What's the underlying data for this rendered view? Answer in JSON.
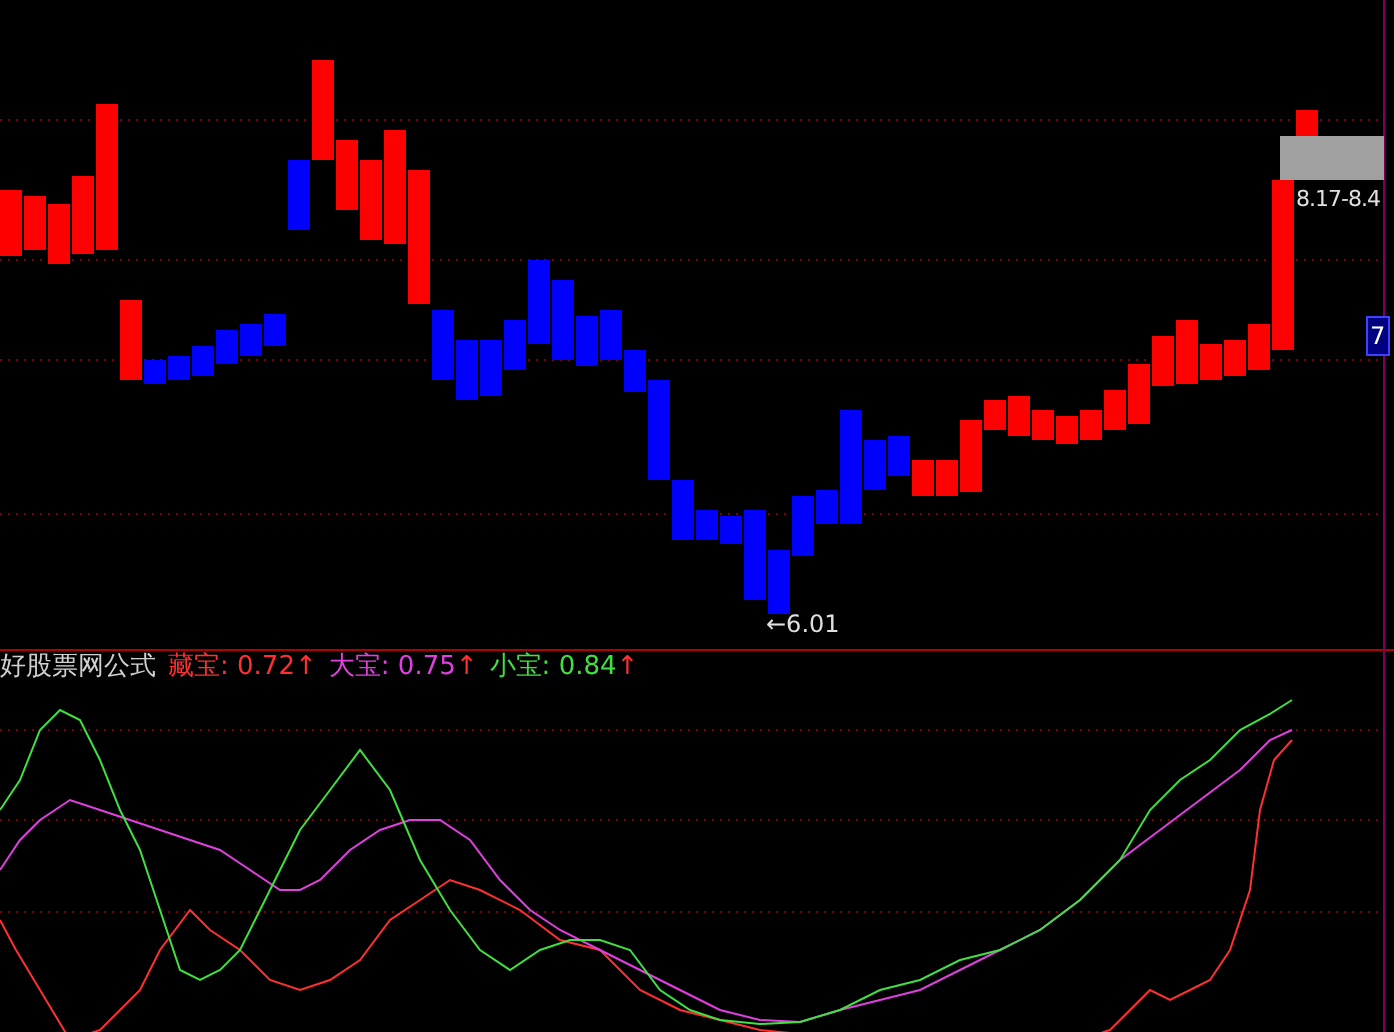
{
  "price_panel": {
    "range_label": "8.17-8.4",
    "low_label": "←6.01",
    "axis_badge": "7"
  },
  "indicator_panel": {
    "title": "好股票网公式",
    "series": [
      {
        "name": "藏宝:",
        "value": "0.72",
        "arrow": "↑",
        "color": "#ff3030"
      },
      {
        "name": "大宝:",
        "value": "0.75",
        "arrow": "↑",
        "color": "#e040e0"
      },
      {
        "name": "小宝:",
        "value": "0.84",
        "arrow": "↑",
        "color": "#40e040"
      }
    ]
  }
}
